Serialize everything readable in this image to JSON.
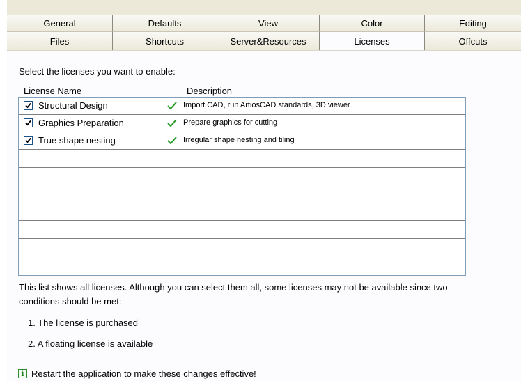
{
  "tabs": {
    "row1": [
      "General",
      "Defaults",
      "View",
      "Color",
      "Editing"
    ],
    "row2": [
      "Files",
      "Shortcuts",
      "Server&Resources",
      "Licenses",
      "Offcuts"
    ],
    "active": "Licenses"
  },
  "panel": {
    "instruction": "Select the licenses you want to enable:",
    "columns": {
      "name": "License Name",
      "description": "Description"
    },
    "licenses": [
      {
        "name": "Structural Design",
        "description": "Import CAD, run ArtiosCAD standards, 3D viewer",
        "checked": true,
        "available": true
      },
      {
        "name": "Graphics Preparation",
        "description": "Prepare graphics for cutting",
        "checked": true,
        "available": true
      },
      {
        "name": "True shape nesting",
        "description": "Irregular shape nesting and tiling",
        "checked": true,
        "available": true
      }
    ],
    "info_text": "This list shows all licenses. Although you can select them all, some licenses may not be available since two conditions should be met:",
    "conditions": [
      "1. The license is purchased",
      "2. A floating license is available"
    ],
    "restart_text": "Restart the application to make these changes effective!"
  },
  "colors": {
    "check_green": "#2a9a2a",
    "tab_bar": "#ece9d8",
    "list_border": "#7f9db9"
  }
}
